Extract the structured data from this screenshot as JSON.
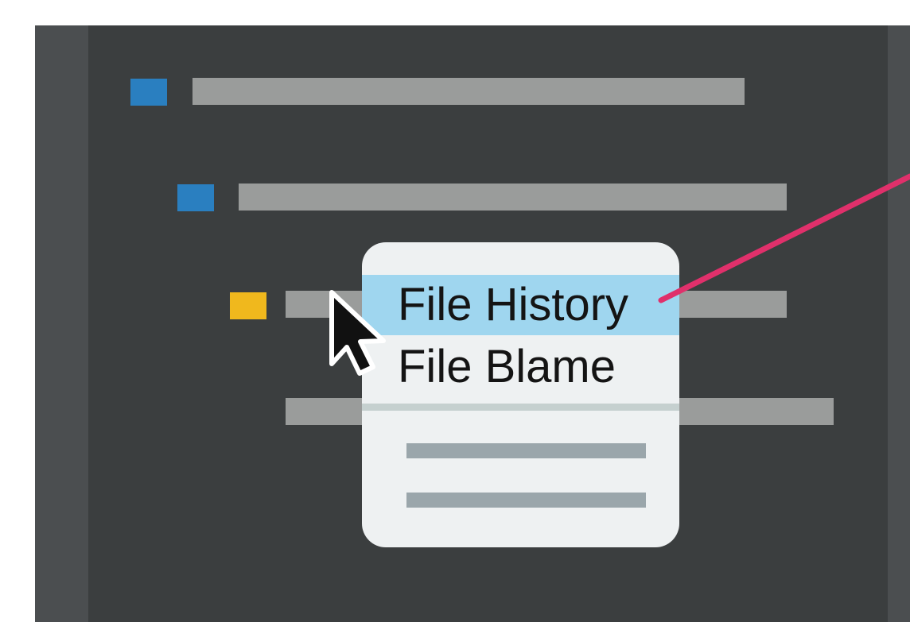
{
  "colors": {
    "background": "#ffffff",
    "panel": "#3b3e3f",
    "gutter": "#4b4e50",
    "placeholder_bar": "#9a9c9b",
    "icon_blue": "#2a7fc0",
    "icon_yellow": "#f0b81d",
    "menu_background": "#eef1f2",
    "menu_highlight": "#9fd6ef",
    "callout_line": "#e0306b"
  },
  "tree": {
    "rows": [
      {
        "icon": "blue-square-icon",
        "level": 1
      },
      {
        "icon": "blue-square-icon",
        "level": 2
      },
      {
        "icon": "yellow-square-icon",
        "level": 3
      },
      {
        "icon": "",
        "level": 4
      }
    ]
  },
  "context_menu": {
    "items": [
      {
        "label": "File History",
        "highlighted": true
      },
      {
        "label": "File Blame",
        "highlighted": false
      }
    ],
    "placeholder_items": 2
  },
  "cursor": "arrow-cursor-icon"
}
